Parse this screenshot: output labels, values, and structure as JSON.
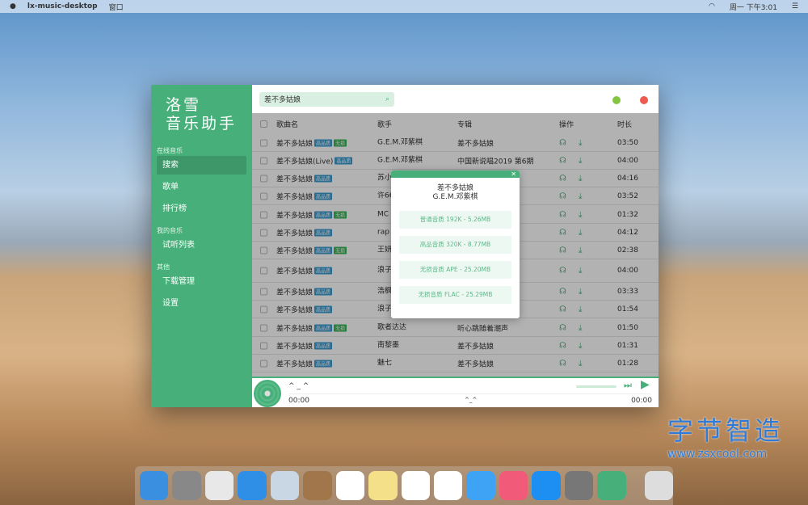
{
  "menubar": {
    "apple": "",
    "app": "lx-music-desktop",
    "menu": "窗口",
    "clock": "周一 下午3:01",
    "wifi": "wifi-icon",
    "list": "☰"
  },
  "sidebar": {
    "logo_line1": "洛雪",
    "logo_line2": "音乐助手",
    "groups": [
      {
        "label": "在线音乐",
        "items": [
          "搜索",
          "歌单",
          "排行榜"
        ]
      },
      {
        "label": "我的音乐",
        "items": [
          "试听列表"
        ]
      },
      {
        "label": "其他",
        "items": [
          "下载管理",
          "设置"
        ]
      }
    ],
    "active": "搜索"
  },
  "search": {
    "value": "差不多姑娘"
  },
  "colors": {
    "accent": "#47b07a",
    "min": "#85c441",
    "close": "#ec5b4d"
  },
  "table": {
    "headers": {
      "name": "歌曲名",
      "artist": "歌手",
      "album": "专辑",
      "ops": "操作",
      "duration": "时长"
    },
    "badges": {
      "hq": "高品质",
      "lossless": "无损"
    },
    "rows": [
      {
        "name": "差不多姑娘",
        "hq": true,
        "ls": true,
        "artist": "G.E.M.邓紫棋",
        "album": "差不多姑娘",
        "duration": "03:50"
      },
      {
        "name": "差不多姑娘(Live)",
        "hq": true,
        "ls": false,
        "artist": "G.E.M.邓紫棋",
        "album": "中国新说唱2019 第6期",
        "duration": "04:00"
      },
      {
        "name": "差不多姑娘",
        "hq": true,
        "ls": false,
        "artist": "苏小",
        "album": "",
        "duration": "04:16"
      },
      {
        "name": "差不多姑娘",
        "hq": true,
        "ls": false,
        "artist": "许66",
        "album": "",
        "duration": "03:52"
      },
      {
        "name": "差不多姑娘",
        "hq": true,
        "ls": true,
        "artist": "MC",
        "album": "",
        "duration": "01:32"
      },
      {
        "name": "差不多姑娘",
        "hq": true,
        "ls": false,
        "artist": "rap",
        "album": "",
        "duration": "04:12"
      },
      {
        "name": "差不多姑娘",
        "hq": true,
        "ls": true,
        "artist": "王妍",
        "album": "",
        "duration": "02:38"
      },
      {
        "name": "差不多姑娘",
        "hq": true,
        "ls": false,
        "artist": "浪子 诗景",
        "album": "",
        "duration": "04:00"
      },
      {
        "name": "差不多姑娘",
        "hq": true,
        "ls": false,
        "artist": "浩枫",
        "album": "",
        "duration": "03:33"
      },
      {
        "name": "差不多姑娘",
        "hq": true,
        "ls": false,
        "artist": "浪子",
        "album": "",
        "duration": "01:54"
      },
      {
        "name": "差不多姑娘",
        "hq": true,
        "ls": true,
        "artist": "歌者达达",
        "album": "听心跳随着潮声",
        "duration": "01:50"
      },
      {
        "name": "差不多姑娘",
        "hq": true,
        "ls": false,
        "artist": "南黎墨",
        "album": "差不多姑娘",
        "duration": "01:31"
      },
      {
        "name": "差不多姑娘",
        "hq": true,
        "ls": false,
        "artist": "魅七",
        "album": "差不多姑娘",
        "duration": "01:28"
      }
    ]
  },
  "player": {
    "title": "^ _ ^",
    "time_current": "00:00",
    "center": "^_^",
    "time_total": "00:00",
    "progress": 0
  },
  "modal": {
    "close": "✕",
    "title": "差不多姑娘",
    "artist": "G.E.M.邓紫棋",
    "options": [
      "普通音质 192K - 5.26MB",
      "高品音质 320K - 8.77MB",
      "无损音质 APE - 25.20MB",
      "无损音质 FLAC - 25.29MB"
    ]
  },
  "dock": [
    "finder",
    "launchpad",
    "chrome",
    "safari",
    "mail",
    "contacts",
    "calendar",
    "notes",
    "reminders",
    "photos",
    "messages",
    "music",
    "app-store",
    "system-preferences",
    "lx-music",
    "trash"
  ],
  "watermark": {
    "line1": "字节智造",
    "line2": "www.zsxcool.com"
  }
}
